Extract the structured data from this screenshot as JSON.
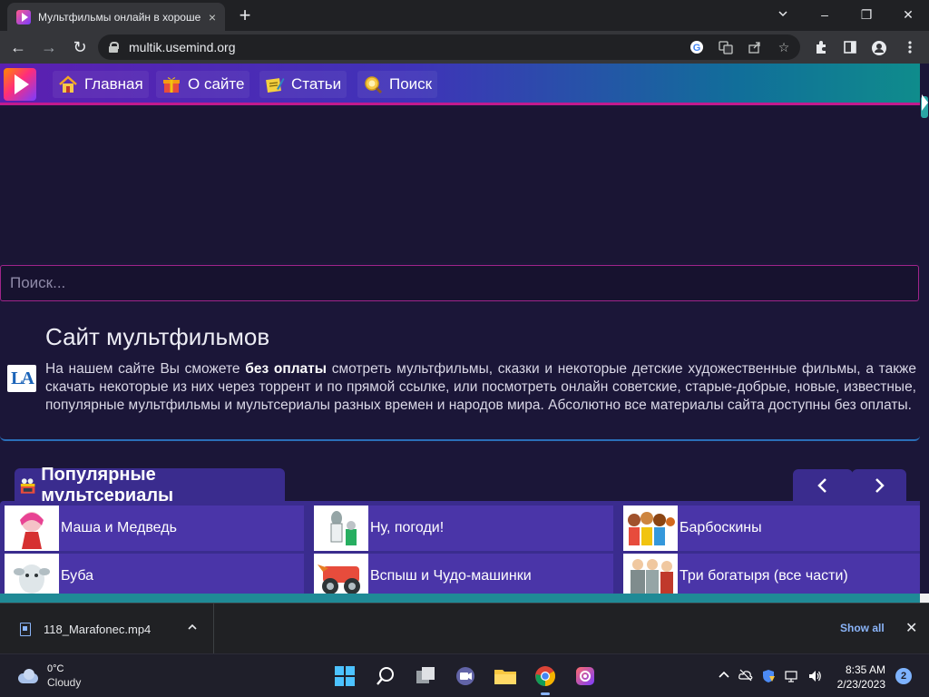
{
  "browser": {
    "tab_title": "Мультфильмы онлайн в хороше",
    "tab_close": "×",
    "new_tab": "+",
    "minimize": "–",
    "restore": "❐",
    "close": "✕",
    "url": "multik.usemind.org",
    "back": "←",
    "forward": "→",
    "reload": "↻"
  },
  "site_nav": {
    "items": [
      {
        "label": "Главная",
        "icon": "house-icon"
      },
      {
        "label": "О сайте",
        "icon": "gift-icon"
      },
      {
        "label": "Статьи",
        "icon": "notepad-icon"
      },
      {
        "label": "Поиск",
        "icon": "magnifier-icon"
      }
    ]
  },
  "search": {
    "placeholder": "Поиск..."
  },
  "intro": {
    "logo_text": "LA",
    "title": "Сайт мультфильмов",
    "text_before": "На нашем сайте Вы сможете ",
    "text_bold": "без оплаты",
    "text_after": " смотреть мультфильмы, сказки и некоторые детские художественные фильмы, а также скачать некоторые из них через торрент и по прямой ссылке, или посмотреть онлайн советские, старые-добрые, новые, известные, популярные мультфильмы и мультсериалы разных времен и народов мира. Абсолютно все материалы сайта доступны без оплаты."
  },
  "popular": {
    "title": "Популярные мультсериалы",
    "items": [
      {
        "label": "Маша и Медведь"
      },
      {
        "label": "Ну, погоди!"
      },
      {
        "label": "Барбоскины"
      },
      {
        "label": "Буба"
      },
      {
        "label": "Вспыш и Чудо-машинки"
      },
      {
        "label": "Три богатыря (все части)"
      }
    ]
  },
  "download": {
    "filename": "118_Marafonec.mp4",
    "show_all": "Show all",
    "close": "✕"
  },
  "taskbar": {
    "temperature": "0°C",
    "condition": "Cloudy",
    "time": "8:35 AM",
    "date": "2/23/2023",
    "notifications": "2"
  }
}
